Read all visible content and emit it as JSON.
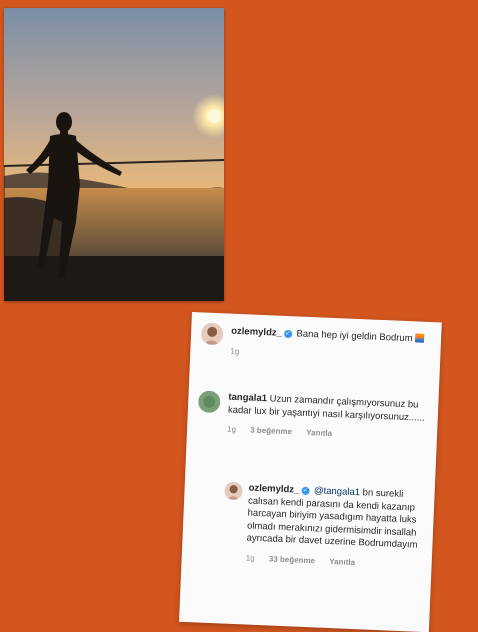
{
  "post": {
    "caption_user": "ozlemyldz_",
    "caption_text": "Bana hep iyi geldin Bodrum",
    "caption_time": "1g"
  },
  "comments": [
    {
      "user": "tangala1",
      "text": "Uzun zamandır çalışmıyorsunuz bu kadar lux bir yaşantıyi nasıl karşılıyorsunuz......",
      "time": "1g",
      "likes": "3 beğenme",
      "reply": "Yanıtla"
    }
  ],
  "reply": {
    "user": "ozlemyldz_",
    "mention": "@tangala1",
    "text": "bn surekli calısan kendi parasını da kendi kazanıp harcayan biriyim yasadıgım hayatta luks olmadı merakınızı gidermisimdir insallah ayrıcada bir davet uzerine Bodrumdayım",
    "time": "1g",
    "likes": "33 beğenme",
    "reply_label": "Yanıtla"
  },
  "icons": {
    "verified": "verified-badge-icon",
    "emoji": "sunset-emoji-icon"
  },
  "colors": {
    "background": "#d3561f",
    "card": "#fbfbfb",
    "verified": "#3897f0"
  }
}
